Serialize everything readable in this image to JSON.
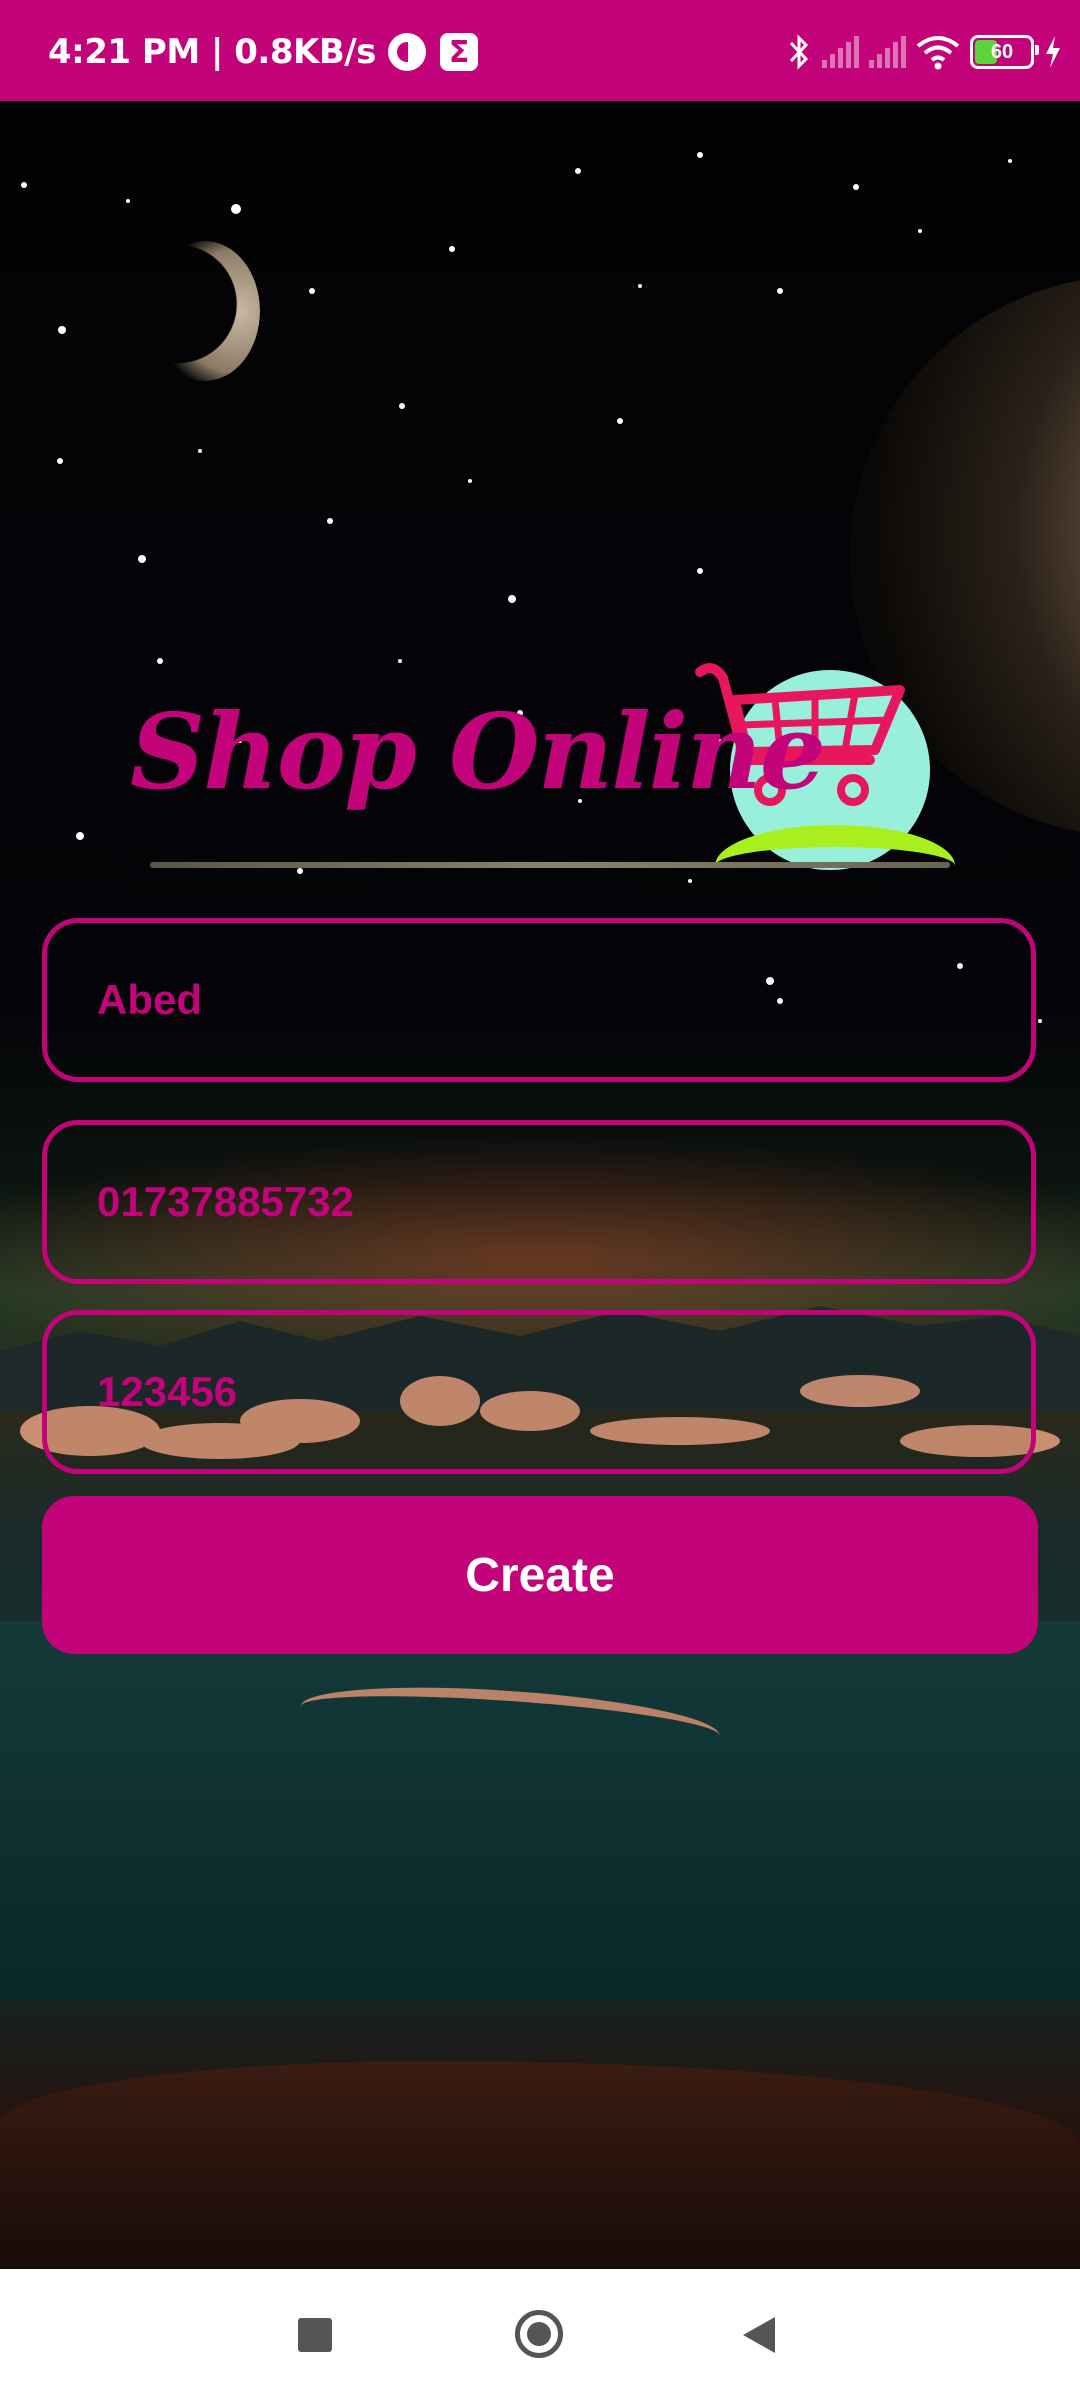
{
  "status_bar": {
    "time_speed": "4:21 PM | 0.8KB/s",
    "sigma_glyph": "Σ",
    "battery": "60",
    "icons": [
      "bluetooth-icon",
      "signal-icon",
      "signal-icon",
      "wifi-icon",
      "battery-icon",
      "charging-icon"
    ]
  },
  "logo": {
    "title": "Shop Online",
    "icon": "shopping-cart-icon",
    "colors": {
      "text": "#c2037a",
      "circle": "#98f0dc",
      "arc": "#a9ef1d"
    }
  },
  "form": {
    "name_value": "Abed",
    "phone_value": "01737885732",
    "password_value": "123456",
    "create_label": "Create"
  },
  "theme": {
    "accent": "#c2037a",
    "nav_bg": "#ffffff"
  },
  "nav": {
    "icons": [
      "recents-icon",
      "home-icon",
      "back-icon"
    ]
  }
}
